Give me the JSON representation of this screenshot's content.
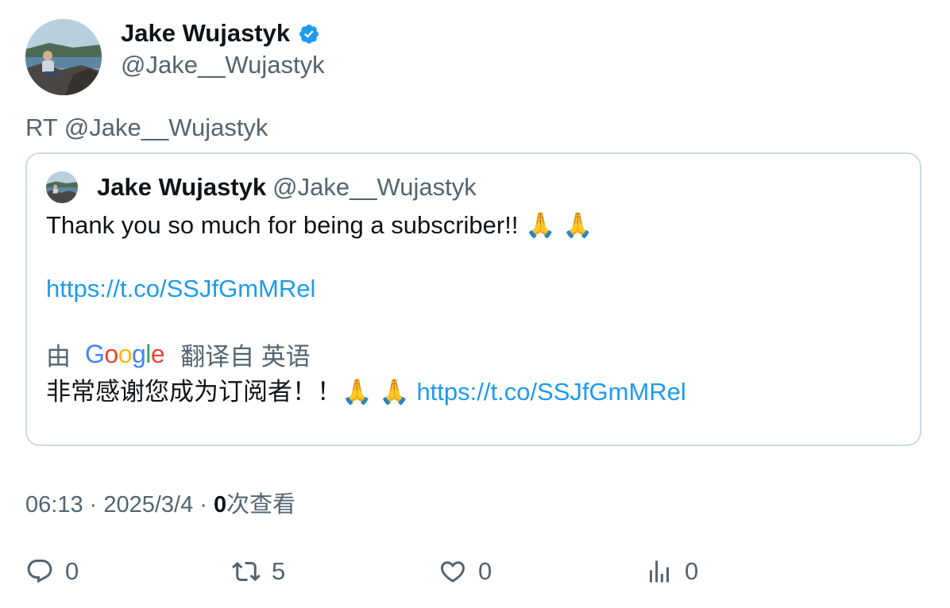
{
  "tweet": {
    "author": {
      "name": "Jake Wujastyk",
      "handle": "@Jake__Wujastyk",
      "verified": true
    },
    "retweet_label": "RT @Jake__Wujastyk",
    "quoted": {
      "name": "Jake Wujastyk",
      "handle": "@Jake__Wujastyk",
      "text": "Thank you so much for being a subscriber!! 🙏 🙏",
      "link": "https://t.co/SSJfGmMRel",
      "translation": {
        "by_label": "由",
        "service": "Google",
        "from_label": "翻译自 英语",
        "text": "非常感谢您成为订阅者！！🙏 🙏",
        "link": "https://t.co/SSJfGmMRel"
      }
    },
    "meta": {
      "time": "06:13",
      "separator": " · ",
      "date": "2025/3/4",
      "views_count": "0",
      "views_label": "次查看"
    },
    "actions": {
      "replies": "0",
      "retweets": "5",
      "likes": "0",
      "views": "0"
    }
  },
  "colors": {
    "text_primary": "#0f1419",
    "text_secondary": "#536471",
    "link": "#1d9bf0",
    "border": "#cfd9de",
    "verified": "#1d9bf0"
  },
  "icons": [
    "verified-badge-icon",
    "reply-icon",
    "retweet-icon",
    "like-icon",
    "views-icon"
  ]
}
